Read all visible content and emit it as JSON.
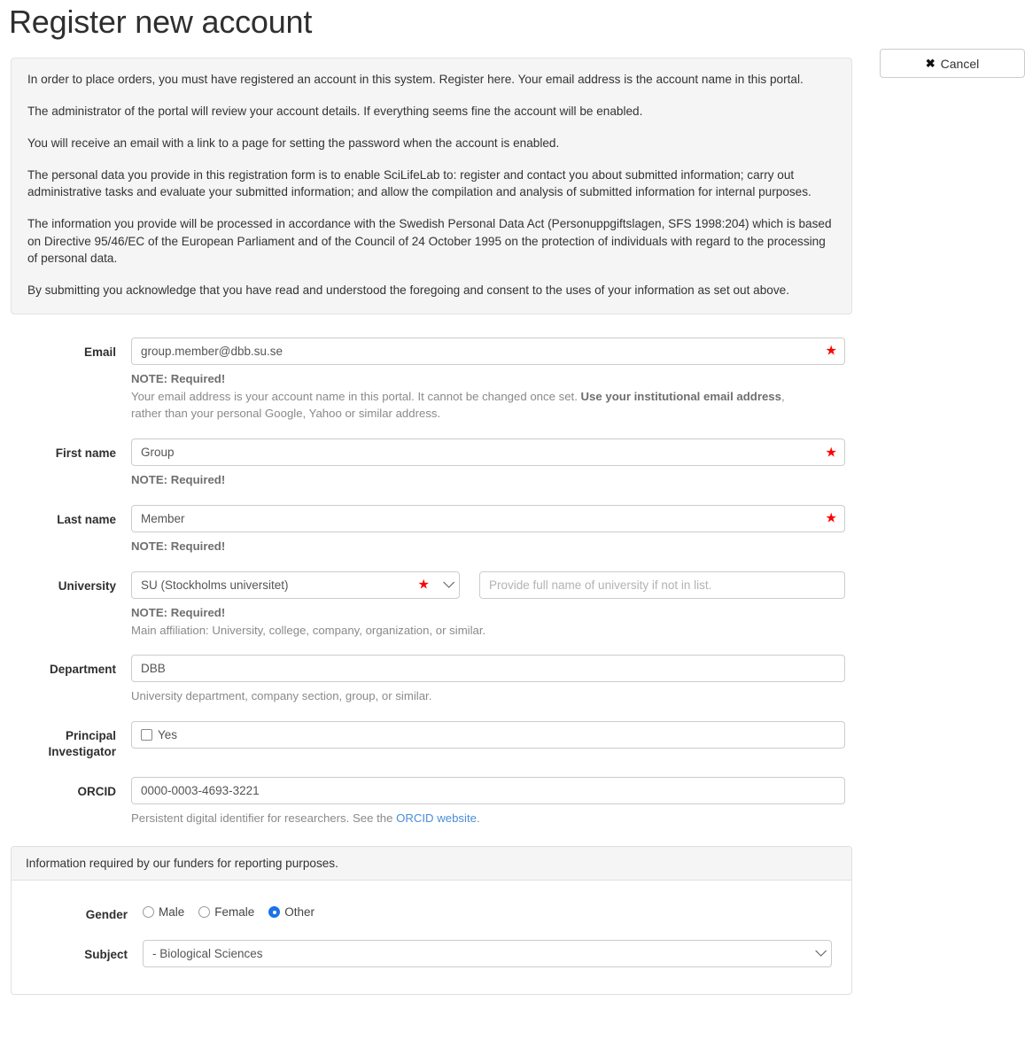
{
  "page": {
    "title": "Register new account"
  },
  "toolbar": {
    "cancel_label": "Cancel",
    "cancel_icon": "close-x-icon"
  },
  "info_panel": {
    "paragraphs": [
      "In order to place orders, you must have registered an account in this system. Register here. Your email address is the account name in this portal.",
      "The administrator of the portal will review your account details. If everything seems fine the account will be enabled.",
      "You will receive an email with a link to a page for setting the password when the account is enabled.",
      "The personal data you provide in this registration form is to enable SciLifeLab to: register and contact you about submitted information; carry out administrative tasks and evaluate your submitted information; and allow the compilation and analysis of submitted information for internal purposes.",
      "The information you provide will be processed in accordance with the Swedish Personal Data Act (Personuppgiftslagen, SFS 1998:204) which is based on Directive 95/46/EC of the European Parliament and of the Council of 24 October 1995 on the protection of individuals with regard to the processing of personal data.",
      "By submitting you acknowledge that you have read and understood the foregoing and consent to the uses of your information as set out above."
    ]
  },
  "form": {
    "email": {
      "label": "Email",
      "value": "group.member@dbb.su.se",
      "required_note": "NOTE: Required!",
      "help_pre": "Your email address is your account name in this portal. It cannot be changed once set. ",
      "help_bold": "Use your institutional email address",
      "help_post": ", rather than your personal Google, Yahoo or similar address."
    },
    "first_name": {
      "label": "First name",
      "value": "Group",
      "required_note": "NOTE: Required!"
    },
    "last_name": {
      "label": "Last name",
      "value": "Member",
      "required_note": "NOTE: Required!"
    },
    "university": {
      "label": "University",
      "selected": "SU (Stockholms universitet)",
      "other_placeholder": "Provide full name of university if not in list.",
      "other_value": "",
      "required_note": "NOTE: Required!",
      "help": "Main affiliation: University, college, company, organization, or similar."
    },
    "department": {
      "label": "Department",
      "value": "DBB",
      "help": "University department, company section, group, or similar."
    },
    "principal_investigator": {
      "label": "Principal Investigator",
      "checkbox_label": "Yes",
      "checked": false
    },
    "orcid": {
      "label": "ORCID",
      "value": "0000-0003-4693-3221",
      "help_pre": "Persistent digital identifier for researchers. See the ",
      "help_link": "ORCID website",
      "help_post": "."
    }
  },
  "funder_panel": {
    "header": "Information required by our funders for reporting purposes.",
    "gender": {
      "label": "Gender",
      "options": [
        "Male",
        "Female",
        "Other"
      ],
      "selected": "Other"
    },
    "subject": {
      "label": "Subject",
      "selected": "- Biological Sciences"
    }
  },
  "colors": {
    "required_star": "#ff0000",
    "link": "#4a8fd6",
    "radio_selected": "#1a73e8",
    "panel_bg": "#f5f5f5"
  }
}
